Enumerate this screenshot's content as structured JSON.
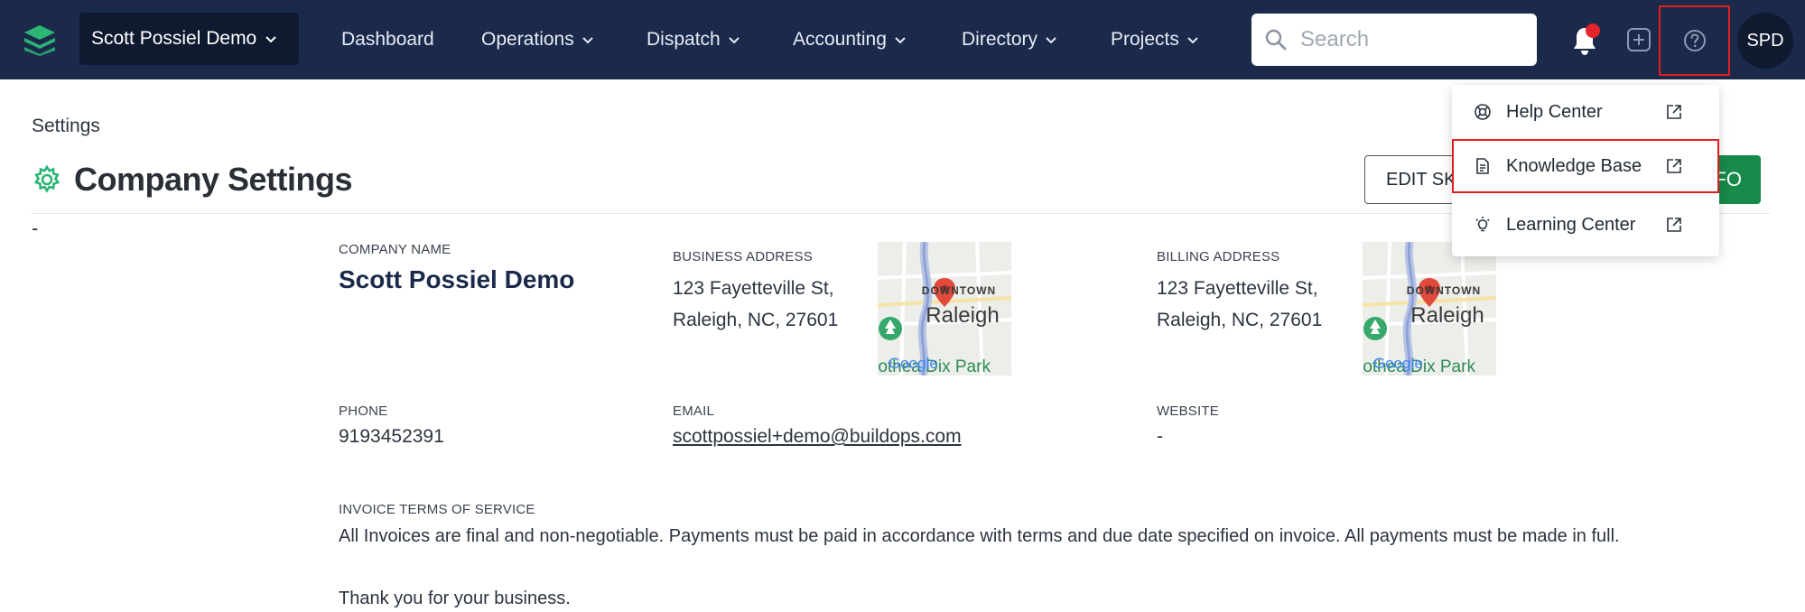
{
  "nav": {
    "company": "Scott Possiel Demo",
    "items": [
      {
        "label": "Dashboard",
        "dropdown": false
      },
      {
        "label": "Operations",
        "dropdown": true
      },
      {
        "label": "Dispatch",
        "dropdown": true
      },
      {
        "label": "Accounting",
        "dropdown": true
      },
      {
        "label": "Directory",
        "dropdown": true
      },
      {
        "label": "Projects",
        "dropdown": true
      }
    ],
    "search_placeholder": "Search",
    "avatar_initials": "SPD",
    "colors": {
      "bg": "#1b2a4a",
      "accent": "#2bb673",
      "notification": "#e3242b"
    }
  },
  "page": {
    "breadcrumb": "Settings",
    "title": "Company Settings",
    "edit_button": "EDIT SK",
    "green_button": "FO",
    "dash": "-"
  },
  "details": {
    "company_name_label": "COMPANY NAME",
    "company_name": "Scott Possiel Demo",
    "business_address_label": "BUSINESS ADDRESS",
    "business_address_line1": "123 Fayetteville St,",
    "business_address_line2": "Raleigh, NC, 27601",
    "billing_address_label": "BILLING ADDRESS",
    "billing_address_line1": "123 Fayetteville St,",
    "billing_address_line2": "Raleigh, NC, 27601",
    "phone_label": "PHONE",
    "phone": "9193452391",
    "email_label": "EMAIL",
    "email": "scottpossiel+demo@buildops.com",
    "website_label": "WEBSITE",
    "website": "-",
    "terms_label": "INVOICE TERMS OF SERVICE",
    "terms": "All Invoices are final and non-negotiable. Payments must be paid in accordance with terms and due date specified on invoice. All payments must be made in full.",
    "thanks": "Thank you for your business."
  },
  "map": {
    "downtown": "DOWNTOWN",
    "city": "Raleigh",
    "park": "rothea Dix Park",
    "google": "Google"
  },
  "help_menu": {
    "items": [
      {
        "label": "Help Center",
        "icon": "lifebuoy-icon"
      },
      {
        "label": "Knowledge Base",
        "icon": "document-icon"
      },
      {
        "label": "Learning Center",
        "icon": "lightbulb-icon"
      }
    ]
  }
}
